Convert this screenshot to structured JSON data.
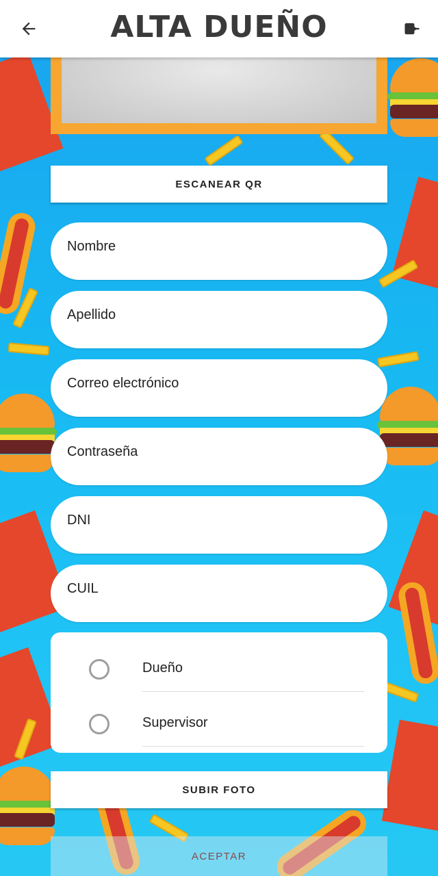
{
  "header": {
    "title": "ALTA DUEÑO",
    "back_icon": "arrow-left-icon",
    "logout_icon": "logout-icon"
  },
  "buttons": {
    "scan_qr": "ESCANEAR QR",
    "upload_photo": "SUBIR FOTO",
    "accept": "ACEPTAR"
  },
  "form": {
    "fields": [
      {
        "placeholder": "Nombre",
        "value": ""
      },
      {
        "placeholder": "Apellido",
        "value": ""
      },
      {
        "placeholder": "Correo electrónico",
        "value": ""
      },
      {
        "placeholder": "Contraseña",
        "value": ""
      },
      {
        "placeholder": "DNI",
        "value": ""
      },
      {
        "placeholder": "CUIL",
        "value": ""
      }
    ],
    "roles": [
      {
        "label": "Dueño",
        "selected": false
      },
      {
        "label": "Supervisor",
        "selected": false
      }
    ]
  },
  "colors": {
    "background": "#1aa3ee",
    "image_frame": "#f6a631",
    "header_bg": "#ffffff",
    "title": "#3a3a3a"
  }
}
